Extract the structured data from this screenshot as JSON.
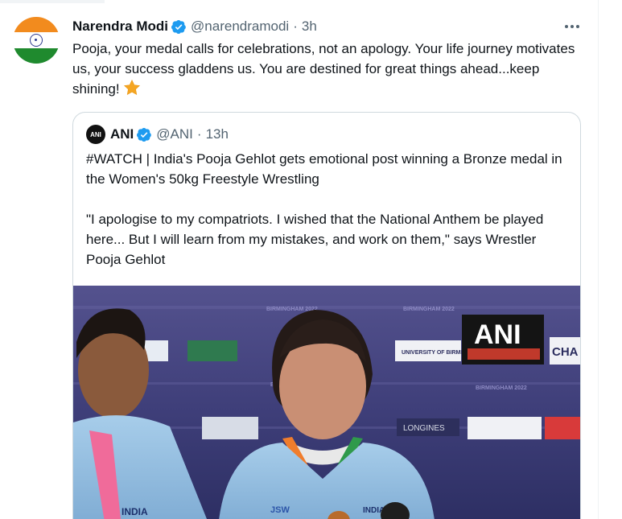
{
  "tweet": {
    "author_name": "Narendra Modi",
    "handle": "@narendramodi",
    "separator": "·",
    "timestamp": "3h",
    "text": "Pooja, your medal calls for celebrations, not an apology. Your life journey motivates us, your success gladdens us. You are destined for great things ahead...keep shining!",
    "emoji_icon": "star-icon",
    "avatar_icon": "india-flag-icon",
    "more_icon": "more-options-icon"
  },
  "quoted_tweet": {
    "author_name": "ANI",
    "handle": "@ANI",
    "separator": "·",
    "timestamp": "13h",
    "avatar_label": "ANI",
    "text_line1": "#WATCH | India's Pooja Gehlot gets emotional post winning a Bronze medal in the Women's 50kg Freestyle Wrestling",
    "text_line2": "\"I apologise to my compatriots. I wished that the National Anthem be played here... But I will learn from my mistakes, and work on them,\" says Wrestler Pooja Gehlot"
  },
  "media": {
    "watermark": "ANI",
    "banner_text": "BIRMINGHAM 2022",
    "board_university": "UNIVERSITY OF BIRMINGHAM",
    "board_longines": "LONGINES",
    "board_cha": "CHA",
    "jersey_left": "INDIA",
    "jersey_center": "INDIA",
    "sponsor": "JSW"
  },
  "colors": {
    "verified_blue": "#1d9bf0",
    "text_primary": "#0f1419",
    "text_secondary": "#536471",
    "border": "#cfd9de",
    "flag_saffron": "#f28b1e",
    "flag_green": "#1f8a2e",
    "chakra_blue": "#2f3b8f",
    "backdrop_purple": "#3f3f7a",
    "jersey_blue": "#8bb8de"
  }
}
